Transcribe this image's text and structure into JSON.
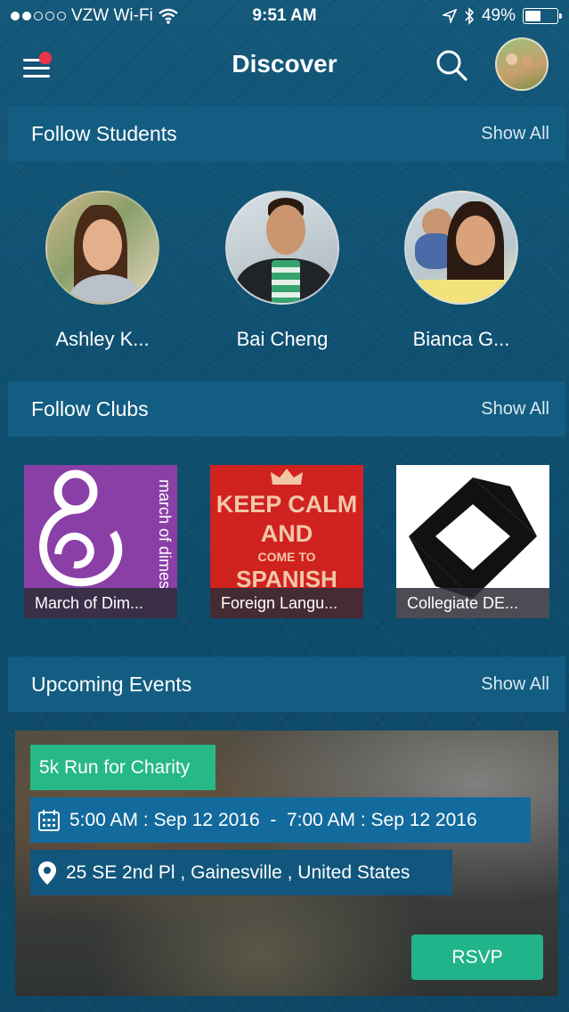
{
  "status_bar": {
    "carrier": "VZW Wi-Fi",
    "time": "9:51 AM",
    "battery": "49%",
    "battery_level": 0.49
  },
  "nav": {
    "title": "Discover",
    "menu_icon": "menu-icon",
    "search_icon": "search-icon",
    "notification_color": "#e8354a"
  },
  "sections": {
    "students": {
      "title": "Follow Students",
      "show_all": "Show All"
    },
    "clubs": {
      "title": "Follow Clubs",
      "show_all": "Show All"
    },
    "events": {
      "title": "Upcoming Events",
      "show_all": "Show All"
    }
  },
  "students": [
    {
      "name": "Ashley K..."
    },
    {
      "name": "Bai Cheng"
    },
    {
      "name": "Bianca G..."
    }
  ],
  "clubs": [
    {
      "name": "March of Dim...",
      "logo_text": "march of dimes",
      "color": "#8a3fa6"
    },
    {
      "name": "Foreign Langu...",
      "logo_lines": [
        "KEEP CALM",
        "AND",
        "COME TO",
        "SPANISH"
      ],
      "color": "#d0221f"
    },
    {
      "name": "Collegiate DE...",
      "color": "#ffffff"
    }
  ],
  "event": {
    "title": "5k Run for Charity",
    "time_range": "5:00 AM : Sep 12 2016  -  7:00 AM : Sep 12 2016",
    "location": "25 SE 2nd Pl , Gainesville , United States",
    "rsvp": "RSVP",
    "accent": "#27b887"
  }
}
